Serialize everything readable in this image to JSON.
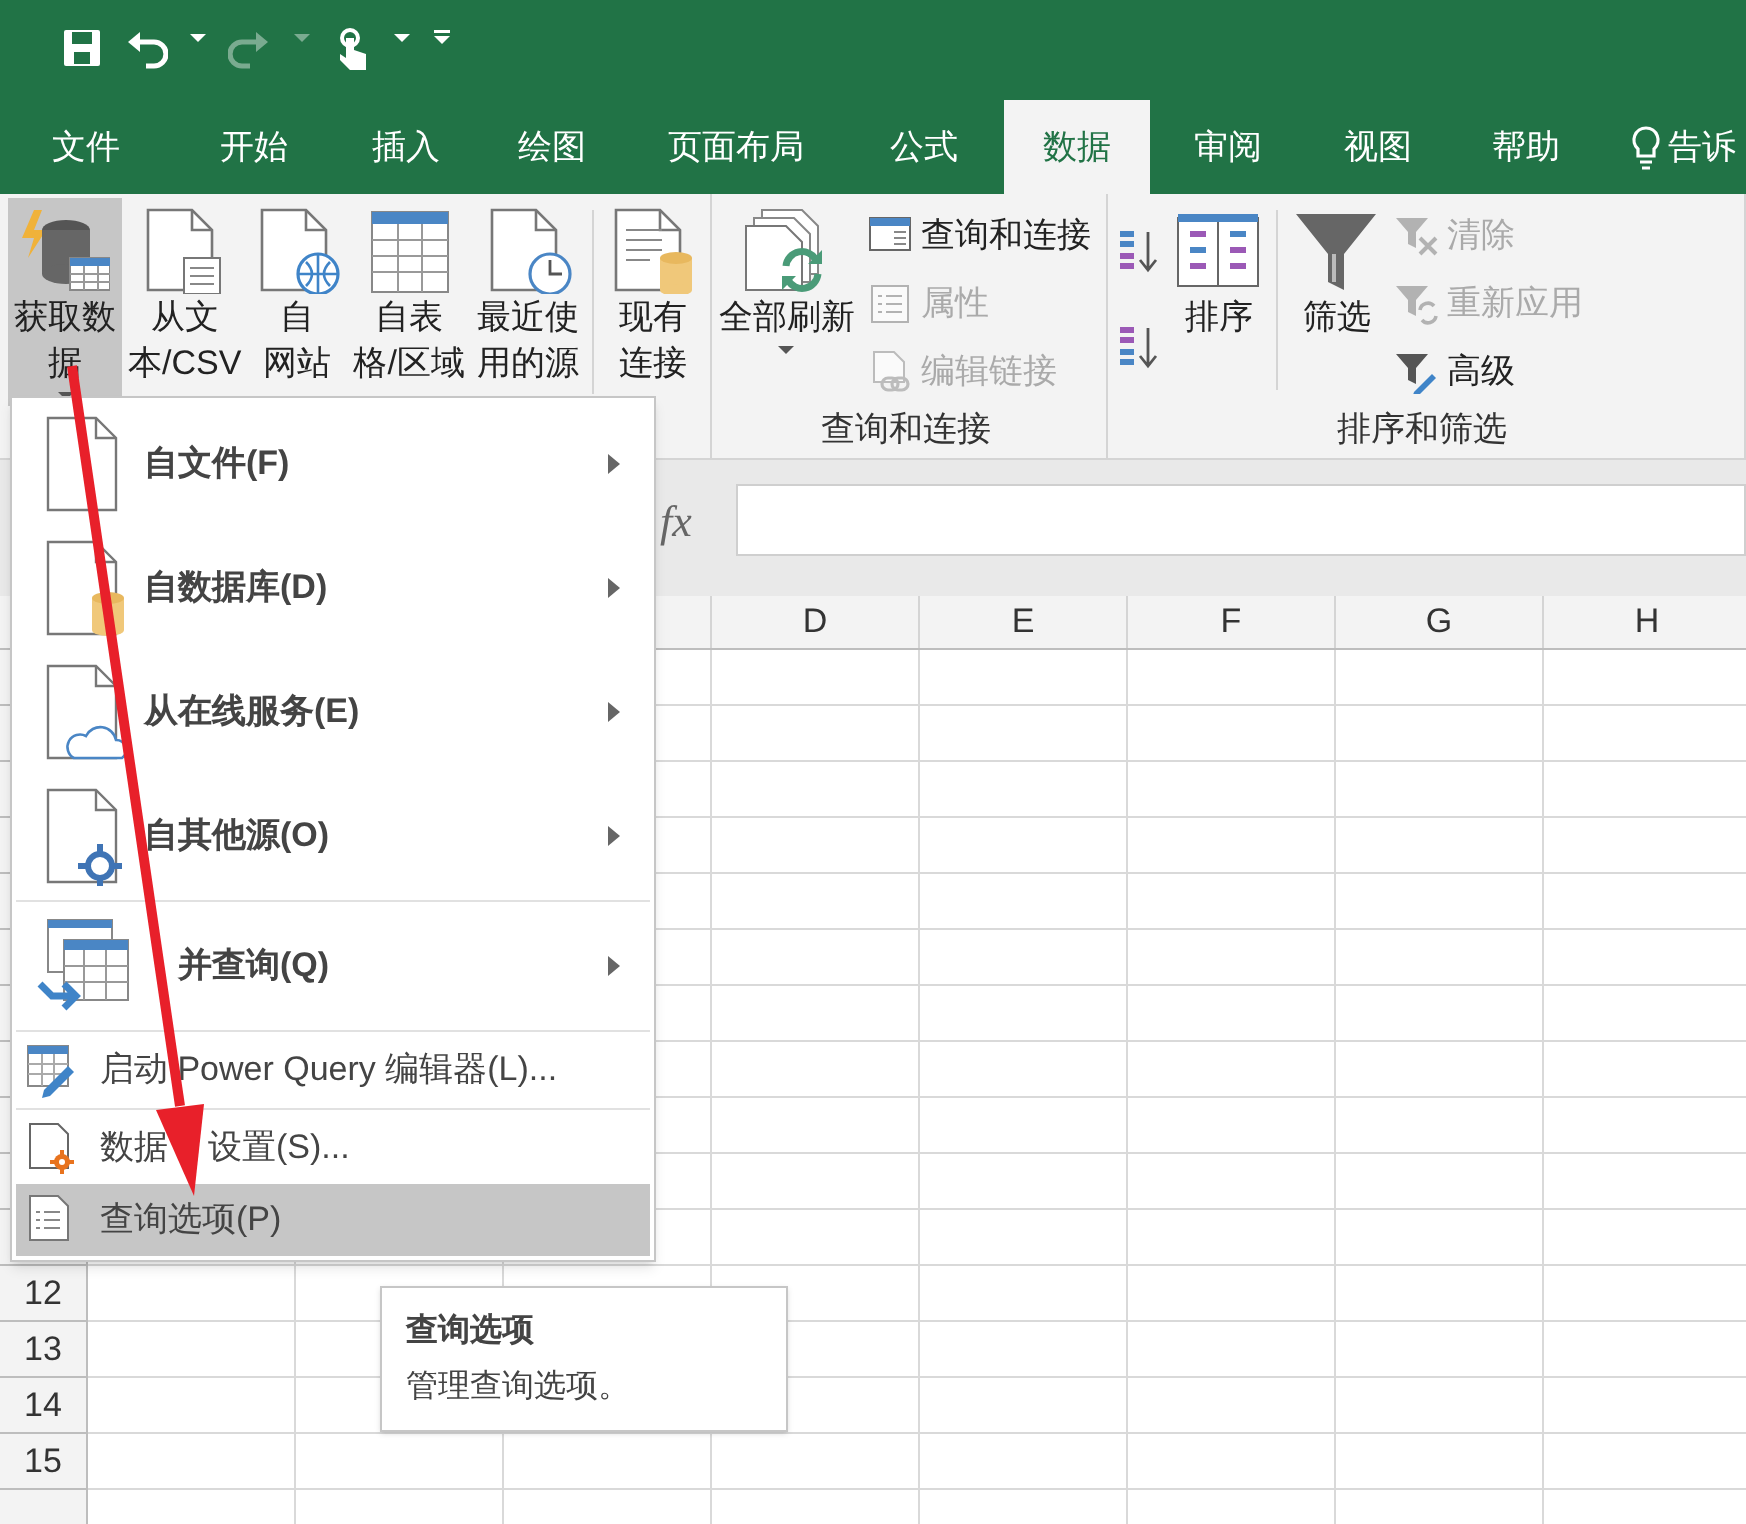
{
  "quick_access_toolbar": [
    {
      "kind": "save",
      "disabled": false
    },
    {
      "kind": "undo",
      "disabled": false
    },
    {
      "kind": "dropdown",
      "disabled": false
    },
    {
      "kind": "redo",
      "disabled": true
    },
    {
      "kind": "dropdown",
      "disabled": true
    },
    {
      "kind": "touch",
      "disabled": false
    },
    {
      "kind": "dropdown",
      "disabled": false
    },
    {
      "kind": "customize",
      "disabled": false
    }
  ],
  "tabs": [
    {
      "label": "文件",
      "selected": false
    },
    {
      "label": "开始",
      "selected": false
    },
    {
      "label": "插入",
      "selected": false
    },
    {
      "label": "绘图",
      "selected": false
    },
    {
      "label": "页面布局",
      "selected": false
    },
    {
      "label": "公式",
      "selected": false
    },
    {
      "label": "数据",
      "selected": true
    },
    {
      "label": "审阅",
      "selected": false
    },
    {
      "label": "视图",
      "selected": false
    },
    {
      "label": "帮助",
      "selected": false
    }
  ],
  "tell_me": {
    "label": "告诉"
  },
  "ribbon": {
    "groups": [
      {
        "buttons": [
          {
            "kind": "large",
            "lines": [
              "获取数",
              "据"
            ],
            "pressed": true,
            "dropdown": true
          },
          {
            "kind": "large",
            "lines": [
              "从文",
              "本/CSV"
            ],
            "pressed": false,
            "dropdown": false
          },
          {
            "kind": "large",
            "lines": [
              "自",
              "网站"
            ],
            "pressed": false,
            "dropdown": false
          },
          {
            "kind": "large",
            "lines": [
              "自表",
              "格/区域"
            ],
            "pressed": false,
            "dropdown": false
          },
          {
            "kind": "large",
            "lines": [
              "最近使",
              "用的源"
            ],
            "pressed": false,
            "dropdown": false
          },
          {
            "kind": "separator"
          },
          {
            "kind": "large",
            "lines": [
              "现有",
              "连接"
            ],
            "pressed": false,
            "dropdown": false
          }
        ]
      },
      {
        "label": "查询和连接",
        "buttons": [
          {
            "kind": "large",
            "lines": [
              "全部刷新"
            ],
            "pressed": false,
            "dropdown": true
          },
          {
            "kind": "small",
            "label": "查询和连接",
            "disabled": false
          },
          {
            "kind": "small",
            "label": "属性",
            "disabled": true
          },
          {
            "kind": "small",
            "label": "编辑链接",
            "disabled": true
          }
        ]
      },
      {
        "label": "排序和筛选",
        "buttons": [
          {
            "kind": "icon",
            "disabled": false
          },
          {
            "kind": "icon",
            "disabled": false
          },
          {
            "kind": "large",
            "lines": [
              "排序"
            ],
            "pressed": false,
            "dropdown": false
          },
          {
            "kind": "separator"
          },
          {
            "kind": "large",
            "lines": [
              "筛选"
            ],
            "pressed": false,
            "dropdown": false
          },
          {
            "kind": "small",
            "label": "清除",
            "disabled": true
          },
          {
            "kind": "small",
            "label": "重新应用",
            "disabled": true
          },
          {
            "kind": "small",
            "label": "高级",
            "disabled": false
          }
        ]
      }
    ]
  },
  "formula_bar": {
    "function_label": "fx"
  },
  "sheet": {
    "columns": [
      "D",
      "E",
      "F",
      "G",
      "H"
    ],
    "rows": [
      "12",
      "13",
      "14",
      "15"
    ]
  },
  "menu": {
    "items": [
      {
        "kind": "large",
        "label": "自文件(F)",
        "submenu": true,
        "selected": false
      },
      {
        "kind": "large",
        "label": "自数据库(D)",
        "submenu": true,
        "selected": false
      },
      {
        "kind": "large",
        "label": "从在线服务(E)",
        "submenu": true,
        "selected": false
      },
      {
        "kind": "large",
        "label": "自其他源(O)",
        "submenu": true,
        "selected": false
      },
      {
        "kind": "separator"
      },
      {
        "kind": "large",
        "label": "并查询(Q)",
        "covered_start": true,
        "submenu": true,
        "selected": false
      },
      {
        "kind": "separator"
      },
      {
        "kind": "small",
        "label": "启动 Power Query 编辑器(L)...",
        "submenu": false,
        "selected": false
      },
      {
        "kind": "separator"
      },
      {
        "kind": "small",
        "label": "数据",
        "label_continued": "设置(S)...",
        "submenu": false,
        "selected": false
      },
      {
        "kind": "small",
        "label": "查询选项(P)",
        "submenu": false,
        "selected": true
      }
    ]
  },
  "tooltip": {
    "title": "查询选项",
    "text": "管理查询选项。"
  }
}
